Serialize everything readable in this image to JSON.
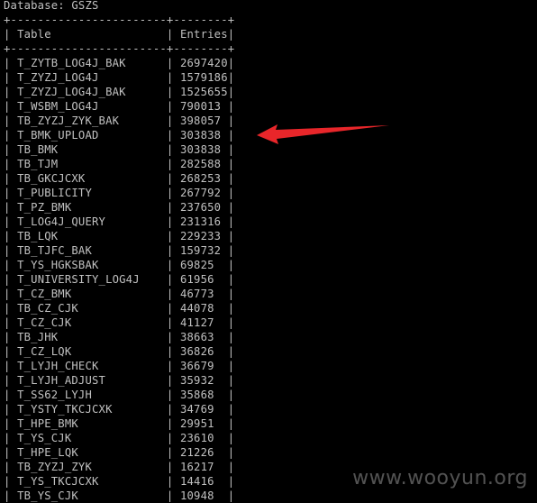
{
  "database_line": "Database: GSZS",
  "border_line": "+-----------------------+--------+",
  "header": {
    "left": "| Table",
    "mid": "| Entries",
    "right": "|"
  },
  "rows": [
    {
      "table": "T_ZYTB_LOG4J_BAK",
      "entries": "2697420"
    },
    {
      "table": "T_ZYZJ_LOG4J",
      "entries": "1579186"
    },
    {
      "table": "T_ZYZJ_LOG4J_BAK",
      "entries": "1525655"
    },
    {
      "table": "T_WSBM_LOG4J",
      "entries": "790013"
    },
    {
      "table": "TB_ZYZJ_ZYK_BAK",
      "entries": "398057"
    },
    {
      "table": "T_BMK_UPLOAD",
      "entries": "303838"
    },
    {
      "table": "TB_BMK",
      "entries": "303838"
    },
    {
      "table": "TB_TJM",
      "entries": "282588"
    },
    {
      "table": "TB_GKCJCXK",
      "entries": "268253"
    },
    {
      "table": "T_PUBLICITY",
      "entries": "267792"
    },
    {
      "table": "T_PZ_BMK",
      "entries": "237650"
    },
    {
      "table": "T_LOG4J_QUERY",
      "entries": "231316"
    },
    {
      "table": "TB_LQK",
      "entries": "229233"
    },
    {
      "table": "TB_TJFC_BAK",
      "entries": "159732"
    },
    {
      "table": "T_YS_HGKSBAK",
      "entries": "69825"
    },
    {
      "table": "T_UNIVERSITY_LOG4J",
      "entries": "61956"
    },
    {
      "table": "T_CZ_BMK",
      "entries": "46773"
    },
    {
      "table": "TB_CZ_CJK",
      "entries": "44078"
    },
    {
      "table": "T_CZ_CJK",
      "entries": "41127"
    },
    {
      "table": "TB_JHK",
      "entries": "38663"
    },
    {
      "table": "T_CZ_LQK",
      "entries": "36826"
    },
    {
      "table": "T_LYJH_CHECK",
      "entries": "36679"
    },
    {
      "table": "T_LYJH_ADJUST",
      "entries": "35932"
    },
    {
      "table": "T_SS62_LYJH",
      "entries": "35868"
    },
    {
      "table": "T_YSTY_TKCJCXK",
      "entries": "34769"
    },
    {
      "table": "T_HPE_BMK",
      "entries": "29951"
    },
    {
      "table": "T_YS_CJK",
      "entries": "23610"
    },
    {
      "table": "T_HPE_LQK",
      "entries": "21226"
    },
    {
      "table": "TB_ZYZJ_ZYK",
      "entries": "16217"
    },
    {
      "table": "T_YS_TKCJCXK",
      "entries": "14416"
    },
    {
      "table": "TB_YS_CJK",
      "entries": "10948"
    }
  ],
  "watermark": "www.wooyun.org",
  "colors": {
    "background": "#000000",
    "text": "#c0c0c0",
    "arrow": "#e8262a"
  },
  "arrow_icon": "red-arrow-pointing-left"
}
